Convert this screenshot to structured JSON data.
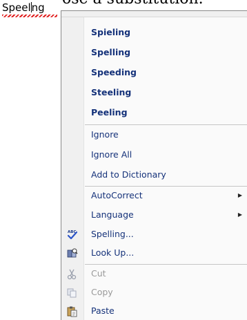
{
  "document": {
    "heading_fragment": "ose a substitution.",
    "word_before_caret": "Speel",
    "word_after_caret": "ng"
  },
  "menu": {
    "suggestions": [
      "Spieling",
      "Spelling",
      "Speeding",
      "Steeling",
      "Peeling"
    ],
    "ignore": "Ignore",
    "ignore_all": "Ignore All",
    "add_to_dictionary": "Add to Dictionary",
    "autocorrect": "AutoCorrect",
    "language": "Language",
    "spelling": "Spelling...",
    "look_up": "Look Up...",
    "cut": "Cut",
    "copy": "Copy",
    "paste": "Paste",
    "submenu_arrow": "▶",
    "icons": {
      "spelling": "abc-check-icon",
      "look_up": "research-book-icon",
      "cut": "scissors-icon",
      "copy": "copy-icon",
      "paste": "clipboard-paste-icon"
    }
  },
  "colors": {
    "menu_text": "#15327a",
    "disabled_text": "#9a9a9a",
    "squiggle": "#e02020"
  }
}
